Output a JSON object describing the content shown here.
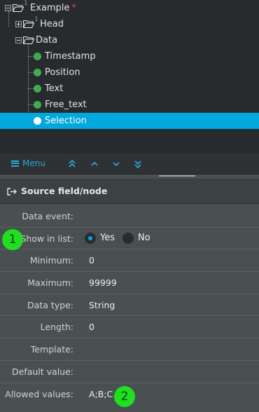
{
  "tree": {
    "root": {
      "label": "Example",
      "count": "1",
      "required_mark": "*"
    },
    "head": {
      "label": "Head",
      "count": "1"
    },
    "data": {
      "label": "Data"
    },
    "fields": [
      "Timestamp",
      "Position",
      "Text",
      "Free_text",
      "Selection"
    ],
    "selected": "Selection"
  },
  "menubar": {
    "menu_label": "Menu",
    "buttons": [
      "move-top-icon",
      "move-up-icon",
      "move-down-icon",
      "move-bottom-icon"
    ],
    "accent": "#29a6dc"
  },
  "panel": {
    "title": "Source field/node"
  },
  "form": {
    "data_event": {
      "label": "Data event:",
      "value": ""
    },
    "show_in_list": {
      "label": "Show in list:",
      "options": [
        "Yes",
        "No"
      ],
      "selected": "Yes"
    },
    "minimum": {
      "label": "Minimum:",
      "value": "0"
    },
    "maximum": {
      "label": "Maximum:",
      "value": "99999"
    },
    "data_type": {
      "label": "Data type:",
      "value": "String"
    },
    "length": {
      "label": "Length:",
      "value": "0"
    },
    "template": {
      "label": "Template:",
      "value": ""
    },
    "default_value": {
      "label": "Default value:",
      "value": ""
    },
    "allowed_values": {
      "label": "Allowed values:",
      "value": "A;B;C"
    }
  },
  "annotations": [
    "1",
    "2"
  ],
  "colors": {
    "selection": "#00a8de",
    "node_dot": "#3fae4a",
    "badge": "#1ee01e",
    "required": "#e0453d"
  }
}
